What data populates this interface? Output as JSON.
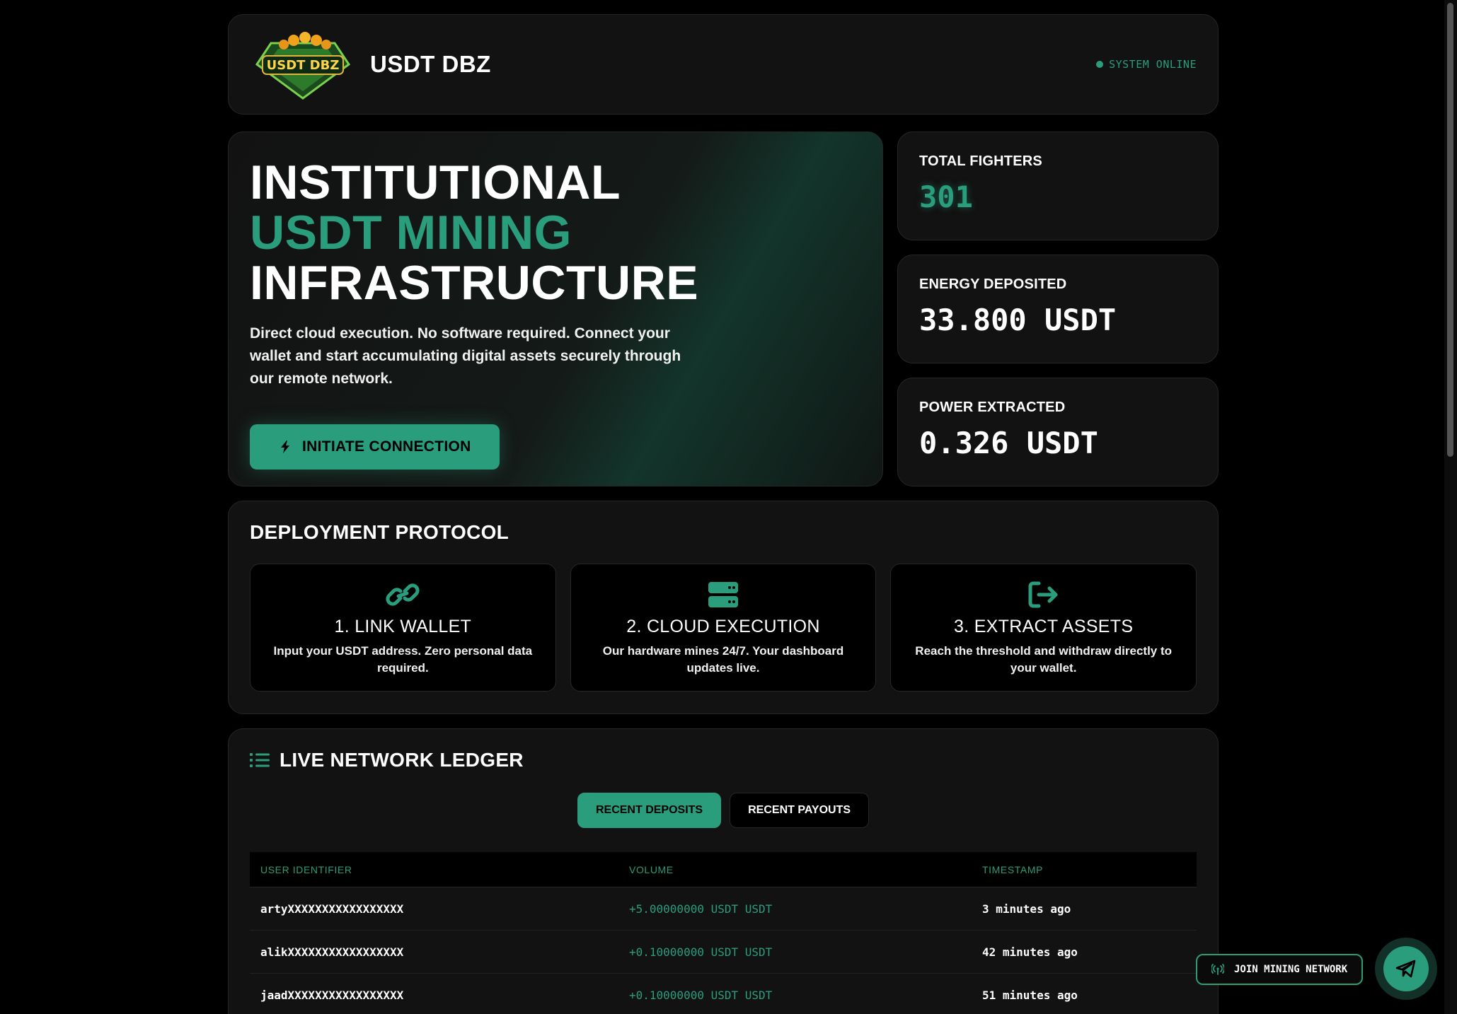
{
  "header": {
    "brand": "USDT DBZ",
    "logo_text": "USDT DBZ",
    "status": "SYSTEM ONLINE"
  },
  "hero": {
    "line1": "INSTITUTIONAL",
    "line2": "USDT MINING",
    "line3": "INFRASTRUCTURE",
    "description": "Direct cloud execution. No software required. Connect your wallet and start accumulating digital assets securely through our remote network.",
    "cta_label": "INITIATE CONNECTION",
    "cta_icon": "bolt-icon"
  },
  "stats": [
    {
      "label": "TOTAL FIGHTERS",
      "value": "301"
    },
    {
      "label": "ENERGY DEPOSITED",
      "value": "33.800 USDT"
    },
    {
      "label": "POWER EXTRACTED",
      "value": "0.326 USDT"
    }
  ],
  "protocol": {
    "title": "DEPLOYMENT PROTOCOL",
    "steps": [
      {
        "icon": "link-icon",
        "title": "1. LINK WALLET",
        "desc": "Input your USDT address. Zero personal data required."
      },
      {
        "icon": "server-icon",
        "title": "2. CLOUD EXECUTION",
        "desc": "Our hardware mines 24/7. Your dashboard updates live."
      },
      {
        "icon": "exit-icon",
        "title": "3. EXTRACT ASSETS",
        "desc": "Reach the threshold and withdraw directly to your wallet."
      }
    ]
  },
  "ledger": {
    "title": "LIVE NETWORK LEDGER",
    "tabs": [
      "RECENT DEPOSITS",
      "RECENT PAYOUTS"
    ],
    "columns": [
      "USER IDENTIFIER",
      "VOLUME",
      "TIMESTAMP"
    ],
    "rows": [
      {
        "user": "artyXXXXXXXXXXXXXXXXX",
        "volume": "+5.00000000 USDT USDT",
        "time": "3 minutes ago"
      },
      {
        "user": "alikXXXXXXXXXXXXXXXXX",
        "volume": "+0.10000000 USDT USDT",
        "time": "42 minutes ago"
      },
      {
        "user": "jaadXXXXXXXXXXXXXXXXX",
        "volume": "+0.10000000 USDT USDT",
        "time": "51 minutes ago"
      }
    ]
  },
  "floating": {
    "join_label": "JOIN MINING NETWORK",
    "telegram_icon": "telegram-icon"
  },
  "colors": {
    "accent": "#2a9d7c",
    "background": "#000000",
    "card": "#121212"
  }
}
